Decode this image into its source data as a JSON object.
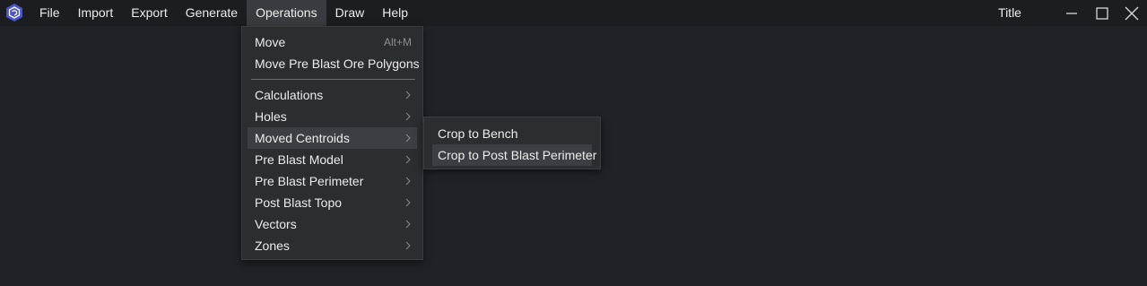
{
  "menubar": {
    "items": [
      "File",
      "Import",
      "Export",
      "Generate",
      "Operations",
      "Draw",
      "Help"
    ],
    "active": "Operations"
  },
  "window": {
    "title": "Title",
    "controls": [
      "minimize-icon",
      "maximize-icon",
      "close-icon"
    ]
  },
  "operations_menu": {
    "top_items": [
      {
        "label": "Move",
        "shortcut": "Alt+M"
      },
      {
        "label": "Move Pre Blast Ore Polygons"
      }
    ],
    "submenu_items": [
      {
        "label": "Calculations"
      },
      {
        "label": "Holes"
      },
      {
        "label": "Moved Centroids",
        "highlighted": true
      },
      {
        "label": "Pre Blast Model"
      },
      {
        "label": "Pre Blast Perimeter"
      },
      {
        "label": "Post Blast Topo"
      },
      {
        "label": "Vectors"
      },
      {
        "label": "Zones"
      }
    ]
  },
  "moved_centroids_submenu": {
    "items": [
      {
        "label": "Crop to Bench"
      },
      {
        "label": "Crop to Post Blast Perimeter",
        "highlighted": true
      }
    ]
  },
  "colors": {
    "background": "#202228",
    "titlebar": "#1c1d21",
    "menu_bg": "#2c2d31",
    "highlight": "#3d3e43",
    "logo_blue": "#4a55c8"
  }
}
